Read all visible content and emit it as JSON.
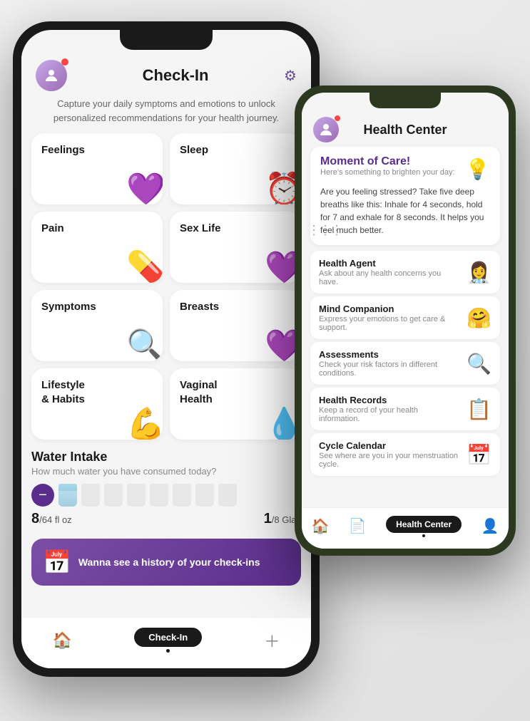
{
  "phone1": {
    "title": "Check-In",
    "subtitle": "Capture your daily symptoms and emotions to unlock personalized recommendations for your health journey.",
    "cards": [
      {
        "id": "feelings",
        "label": "Feelings",
        "emoji": "💜"
      },
      {
        "id": "sleep",
        "label": "Sleep",
        "emoji": "⏰"
      },
      {
        "id": "pain",
        "label": "Pain",
        "emoji": "💊"
      },
      {
        "id": "sex_life",
        "label": "Sex Life",
        "emoji": "💜"
      },
      {
        "id": "symptoms",
        "label": "Symptoms",
        "emoji": "🔍"
      },
      {
        "id": "breasts",
        "label": "Breasts",
        "emoji": "💜"
      },
      {
        "id": "lifestyle",
        "label": "Lifestyle\n& Habits",
        "emoji": "💪"
      },
      {
        "id": "vaginal_health",
        "label": "Vaginal\nHealth",
        "emoji": "💧"
      }
    ],
    "water": {
      "title": "Water Intake",
      "subtitle": "How much water you have consumed today?",
      "fl_oz_current": "8",
      "fl_oz_total": "64",
      "glasses_current": "1",
      "glasses_total": "8",
      "fl_oz_label": "fl oz",
      "glass_label": "Glas"
    },
    "banner": {
      "text": "Wanna see a history of your check-ins",
      "icon": "📅"
    },
    "nav": [
      {
        "id": "home",
        "icon": "🏠",
        "active": false
      },
      {
        "id": "checkin",
        "label": "Check-In",
        "active": true
      },
      {
        "id": "plus",
        "icon": "➕",
        "active": false
      }
    ]
  },
  "phone2": {
    "title": "Health Center",
    "moment_card": {
      "title": "Moment of Care!",
      "subtitle": "Here's something to brighten your day:",
      "text": "Are you feeling stressed? Take five deep breaths like this: Inhale for 4 seconds, hold for 7 and exhale for 8 seconds. It helps you feel much better.",
      "emoji": "💡"
    },
    "features": [
      {
        "id": "health_agent",
        "title": "Health Agent",
        "subtitle": "Ask about any health concerns you have.",
        "emoji": "👩‍⚕️"
      },
      {
        "id": "mind_companion",
        "title": "Mind Companion",
        "subtitle": "Express your emotions to get care & support.",
        "emoji": "🤗"
      },
      {
        "id": "assessments",
        "title": "Assessments",
        "subtitle": "Check your risk factors in different conditions.",
        "emoji": "🔍"
      },
      {
        "id": "health_records",
        "title": "Health Records",
        "subtitle": "Keep a record of your health information.",
        "emoji": "📋"
      },
      {
        "id": "cycle_calendar",
        "title": "Cycle Calendar",
        "subtitle": "See where are you in your menstruation cycle.",
        "emoji": "📅"
      }
    ],
    "nav": [
      {
        "id": "home",
        "icon": "🏠"
      },
      {
        "id": "records",
        "icon": "📄"
      },
      {
        "id": "health_center",
        "label": "Health Center",
        "active": true
      },
      {
        "id": "profile",
        "icon": "👤"
      }
    ]
  }
}
